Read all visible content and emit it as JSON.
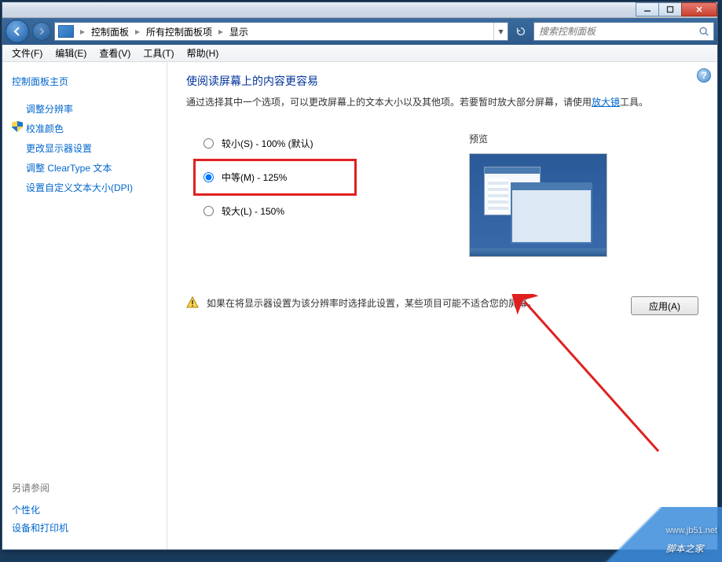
{
  "breadcrumb": {
    "root": "控制面板",
    "mid": "所有控制面板项",
    "leaf": "显示"
  },
  "search": {
    "placeholder": "搜索控制面板"
  },
  "menu": {
    "file": "文件(F)",
    "edit": "编辑(E)",
    "view": "查看(V)",
    "tools": "工具(T)",
    "help": "帮助(H)"
  },
  "sidebar": {
    "home": "控制面板主页",
    "links": [
      "调整分辨率",
      "校准颜色",
      "更改显示器设置",
      "调整 ClearType 文本",
      "设置自定义文本大小(DPI)"
    ],
    "seeAlso": "另请参阅",
    "related": [
      "个性化",
      "设备和打印机"
    ]
  },
  "main": {
    "heading": "使阅读屏幕上的内容更容易",
    "desc1": "通过选择其中一个选项，可以更改屏幕上的文本大小以及其他项。若要暂时放大部分屏幕，请使用",
    "descLink": "放大镜",
    "desc2": "工具。",
    "options": {
      "small": "较小(S) - 100% (默认)",
      "medium": "中等(M) - 125%",
      "large": "较大(L) - 150%"
    },
    "previewLabel": "预览",
    "warning": "如果在将显示器设置为该分辨率时选择此设置，某些项目可能不适合您的屏幕。",
    "applyBtn": "应用(A)"
  },
  "watermark": {
    "brand": "脚本之家",
    "url": "www.jb51.net"
  }
}
